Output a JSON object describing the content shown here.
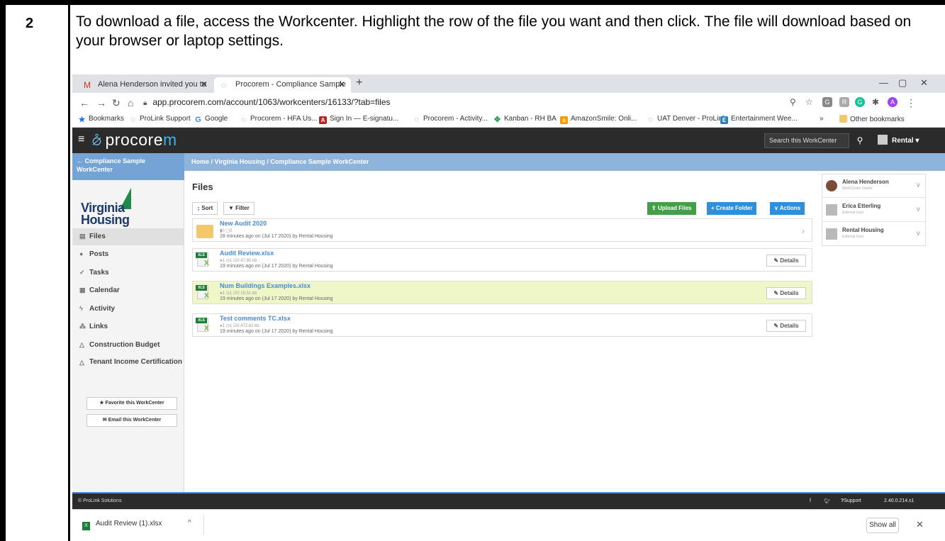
{
  "doc": {
    "step": "2",
    "instruction": "To download a file, access the Workcenter. Highlight the row of the file you want and then click.  The file will download based on your browser or laptop settings."
  },
  "browser": {
    "tabs": [
      {
        "label": "Alena Henderson invited you to",
        "icon": "gmail-icon",
        "active": false
      },
      {
        "label": "Procorem - Compliance Sample",
        "icon": "procorem-icon",
        "active": true
      }
    ],
    "url": "app.procorem.com/account/1063/workcenters/16133/?tab=files",
    "bookmarks": [
      "Bookmarks",
      "ProLink Support",
      "Google",
      "Procorem - HFA Us...",
      "Sign In — E-signatu...",
      "Procorem - Activity...",
      "Kanban - RH BA",
      "AmazonSmile: Onli...",
      "UAT Denver - ProLink",
      "Entertainment Wee...",
      "»",
      "Other bookmarks"
    ],
    "profile_initial": "A"
  },
  "app": {
    "logo_text": "procore",
    "logo_tail": "m",
    "search_placeholder": "Search this WorkCenter",
    "user_label": "Rental",
    "sidebar_title": "← Compliance Sample WorkCenter",
    "breadcrumb": "Home  /  Virginia Housing  /  Compliance Sample WorkCenter",
    "org_logo": {
      "line1": "Virginia",
      "line2": "Housing"
    },
    "nav": [
      {
        "label": "Files",
        "icon": "file-icon",
        "active": true
      },
      {
        "label": "Posts",
        "icon": "comments-icon",
        "active": false
      },
      {
        "label": "Tasks",
        "icon": "check-icon",
        "active": false
      },
      {
        "label": "Calendar",
        "icon": "calendar-icon",
        "active": false
      },
      {
        "label": "Activity",
        "icon": "bolt-icon",
        "active": false
      },
      {
        "label": "Links",
        "icon": "sitemap-icon",
        "active": false
      },
      {
        "label": "Construction Budget",
        "icon": "flask-icon",
        "active": false
      },
      {
        "label": "Tenant Income Certification",
        "icon": "flask-icon",
        "active": false
      }
    ],
    "favorite_btn": "★ Favorite this WorkCenter",
    "email_btn": "✉ Email this WorkCenter",
    "files_heading": "Files",
    "sort_btn": "Sort",
    "filter_btn": "Filter",
    "upload_btn": "Upload Files",
    "create_folder_btn": "+ Create Folder",
    "actions_btn": "Actions",
    "accent_green": "#43a047",
    "accent_blue": "#2f8fd8",
    "files": [
      {
        "name": "New Audit 2020",
        "type": "folder",
        "meta": "▮0    ▢0",
        "sub": "28 minutes ago on (Jul 17 2020) by Rental Housing",
        "highlighted": false
      },
      {
        "name": "Audit Review.xlsx",
        "type": "xlsx",
        "meta": "●1    ◷1    ☑0    47.80 kb",
        "sub": "19 minutes ago on (Jul 17 2020) by Rental Housing",
        "highlighted": false
      },
      {
        "name": "Num Buildings Examples.xlsx",
        "type": "xlsx",
        "meta": "●1    ◷1    ☑0    15.51 kb",
        "sub": "19 minutes ago on (Jul 17 2020) by Rental Housing",
        "highlighted": true
      },
      {
        "name": "Test comments TC.xlsx",
        "type": "xlsx",
        "meta": "●1    ◷1    ☑0    472.62 kb",
        "sub": "19 minutes ago on (Jul 17 2020) by Rental Housing",
        "highlighted": false
      }
    ],
    "details_label": "Details",
    "members": [
      {
        "name": "Alena Henderson",
        "role": "WorkCenter Owner"
      },
      {
        "name": "Erica Etterling",
        "role": "External User"
      },
      {
        "name": "Rental Housing",
        "role": "External User"
      }
    ],
    "footer_copy": "© ProLink Solutions",
    "footer_support": "Support",
    "footer_version": "2.40.0.214.s1"
  },
  "download_bar": {
    "file": "Audit Review (1).xlsx",
    "show_all": "Show all"
  }
}
